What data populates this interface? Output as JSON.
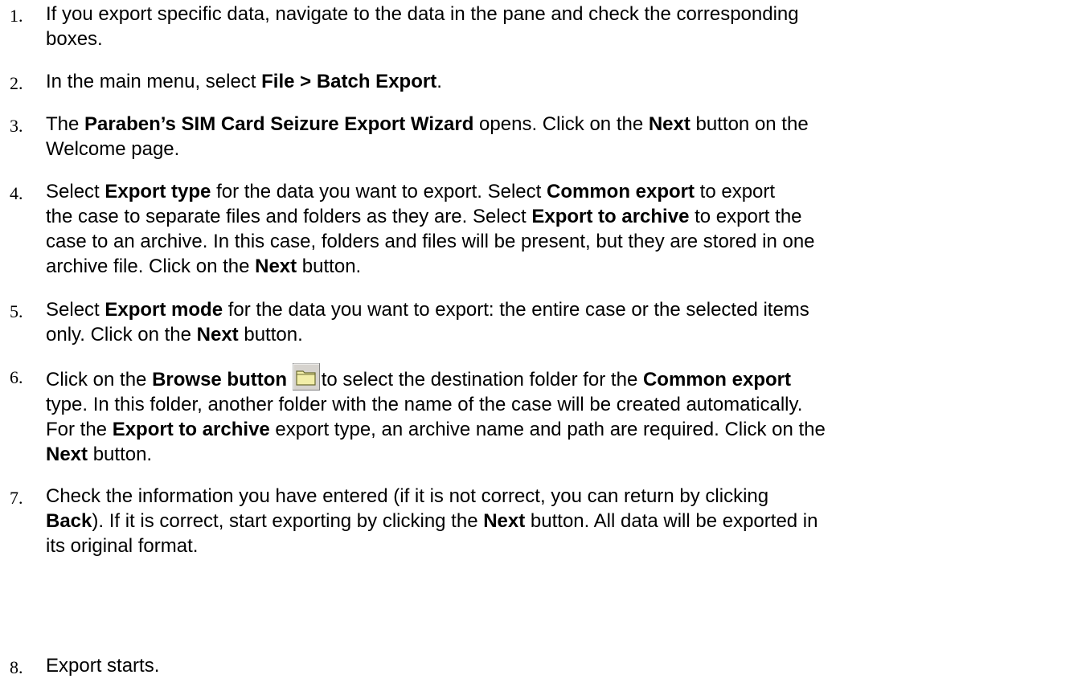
{
  "steps": [
    {
      "number": "1.",
      "lines": [
        [
          {
            "t": "If you export specific data, navigate to the data in the pane and check the corresponding"
          }
        ],
        [
          {
            "t": "boxes."
          }
        ]
      ]
    },
    {
      "number": "2.",
      "lines": [
        [
          {
            "t": "In the main menu, select "
          },
          {
            "t": "File > Batch Export",
            "b": true
          },
          {
            "t": "."
          }
        ]
      ]
    },
    {
      "number": "3.",
      "lines": [
        [
          {
            "t": "The "
          },
          {
            "t": "Paraben’s SIM Card Seizure Export Wizard",
            "b": true
          },
          {
            "t": " opens. Click on the "
          },
          {
            "t": "Next",
            "b": true
          },
          {
            "t": " button on the"
          }
        ],
        [
          {
            "t": "Welcome page."
          }
        ]
      ]
    },
    {
      "number": "4.",
      "lines": [
        [
          {
            "t": "Select "
          },
          {
            "t": "Export type",
            "b": true
          },
          {
            "t": " for the data you want to export. Select "
          },
          {
            "t": "Common export",
            "b": true
          },
          {
            "t": " to export"
          }
        ],
        [
          {
            "t": "the case to separate files and folders as they are. Select "
          },
          {
            "t": "Export to archive",
            "b": true
          },
          {
            "t": " to export the"
          }
        ],
        [
          {
            "t": "case to an archive. In this case, folders and files will be present, but they are stored in one"
          }
        ],
        [
          {
            "t": "archive file.  Click on the "
          },
          {
            "t": "Next",
            "b": true
          },
          {
            "t": " button."
          }
        ]
      ]
    },
    {
      "number": "5.",
      "lines": [
        [
          {
            "t": "Select "
          },
          {
            "t": "Export mode",
            "b": true
          },
          {
            "t": " for the data you want to export: the entire case or the selected items"
          }
        ],
        [
          {
            "t": "only. Click on the "
          },
          {
            "t": "Next",
            "b": true
          },
          {
            "t": " button."
          }
        ]
      ]
    },
    {
      "number": "6.",
      "lines": [
        [
          {
            "t": "Click on the "
          },
          {
            "t": "Browse button ",
            "b": true
          },
          {
            "icon": "folder-icon"
          },
          {
            "t": "to select the destination folder for the "
          },
          {
            "t": "Common export",
            "b": true
          }
        ],
        [
          {
            "t": "type. In this folder, another folder with the name of the case will be created automatically."
          }
        ],
        [
          {
            "t": "For the "
          },
          {
            "t": "Export to archive",
            "b": true
          },
          {
            "t": " export type, an archive name and path are required. Click on the"
          }
        ],
        [
          {
            "t": "Next",
            "b": true
          },
          {
            "t": " button."
          }
        ]
      ]
    },
    {
      "number": "7.",
      "lines": [
        [
          {
            "t": "Check the information you have entered (if it is not correct, you can return by clicking"
          }
        ],
        [
          {
            "t": "Back",
            "b": true
          },
          {
            "t": "). If it is correct, start exporting by clicking the "
          },
          {
            "t": "Next",
            "b": true
          },
          {
            "t": " button. All data will be exported in"
          }
        ],
        [
          {
            "t": "its original format."
          }
        ]
      ]
    },
    {
      "number": "8.",
      "lines": [
        [
          {
            "t": "Export starts."
          }
        ]
      ]
    }
  ],
  "colors": {
    "text": "#000000",
    "background": "#ffffff",
    "folder_fill": "#f2eea8",
    "folder_stroke": "#6b6b30",
    "button_face": "#d6d3ce"
  }
}
